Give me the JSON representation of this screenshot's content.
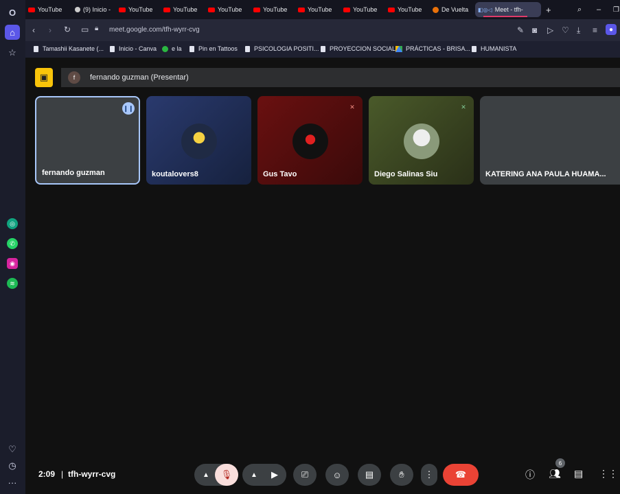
{
  "tabs": [
    {
      "label": "YouTube",
      "kind": "yt"
    },
    {
      "label": "(9) Inicio -",
      "kind": "gh"
    },
    {
      "label": "YouTube",
      "kind": "yt"
    },
    {
      "label": "YouTube",
      "kind": "yt"
    },
    {
      "label": "YouTube",
      "kind": "yt"
    },
    {
      "label": "YouTube",
      "kind": "yt"
    },
    {
      "label": "YouTube",
      "kind": "yt"
    },
    {
      "label": "YouTube",
      "kind": "yt"
    },
    {
      "label": "YouTube",
      "kind": "yt"
    },
    {
      "label": "De Vuelta",
      "kind": "dv"
    },
    {
      "label": "Meet - tfh-",
      "kind": "active"
    }
  ],
  "address": {
    "url": "meet.google.com/tfh-wyrr-cvg"
  },
  "bookmarks": [
    {
      "label": "Tamashii Kasanete (...",
      "icon": "page"
    },
    {
      "label": "Inicio - Canva",
      "icon": "page"
    },
    {
      "label": "e la",
      "icon": "whatsapp"
    },
    {
      "label": "Pin en Tattoos",
      "icon": "page"
    },
    {
      "label": "PSICOLOGIA POSITI...",
      "icon": "page"
    },
    {
      "label": "PROYECCION SOCIAL",
      "icon": "page"
    },
    {
      "label": "PRÁCTICAS - BRISA...",
      "icon": "drive"
    },
    {
      "label": "HUMANISTA",
      "icon": "page"
    }
  ],
  "presenting": {
    "avatar": "f",
    "label": "fernando guzman (Presentar)"
  },
  "participants": [
    {
      "name": "fernando guzman",
      "state": "speaking"
    },
    {
      "name": "koutalovers8",
      "state": "none"
    },
    {
      "name": "Gus Tavo",
      "state": "muted"
    },
    {
      "name": "Diego Salinas Siu",
      "state": "muted"
    },
    {
      "name": "KATERING ANA PAULA HUAMA...",
      "state": "none"
    }
  ],
  "meeting": {
    "time": "2:09",
    "separator": "|",
    "code": "tfh-wyrr-cvg",
    "people_count": "6"
  },
  "colors": {
    "accent": "#f9c40a",
    "hangup": "#ea4335",
    "mic_off": "#f9dedc"
  }
}
